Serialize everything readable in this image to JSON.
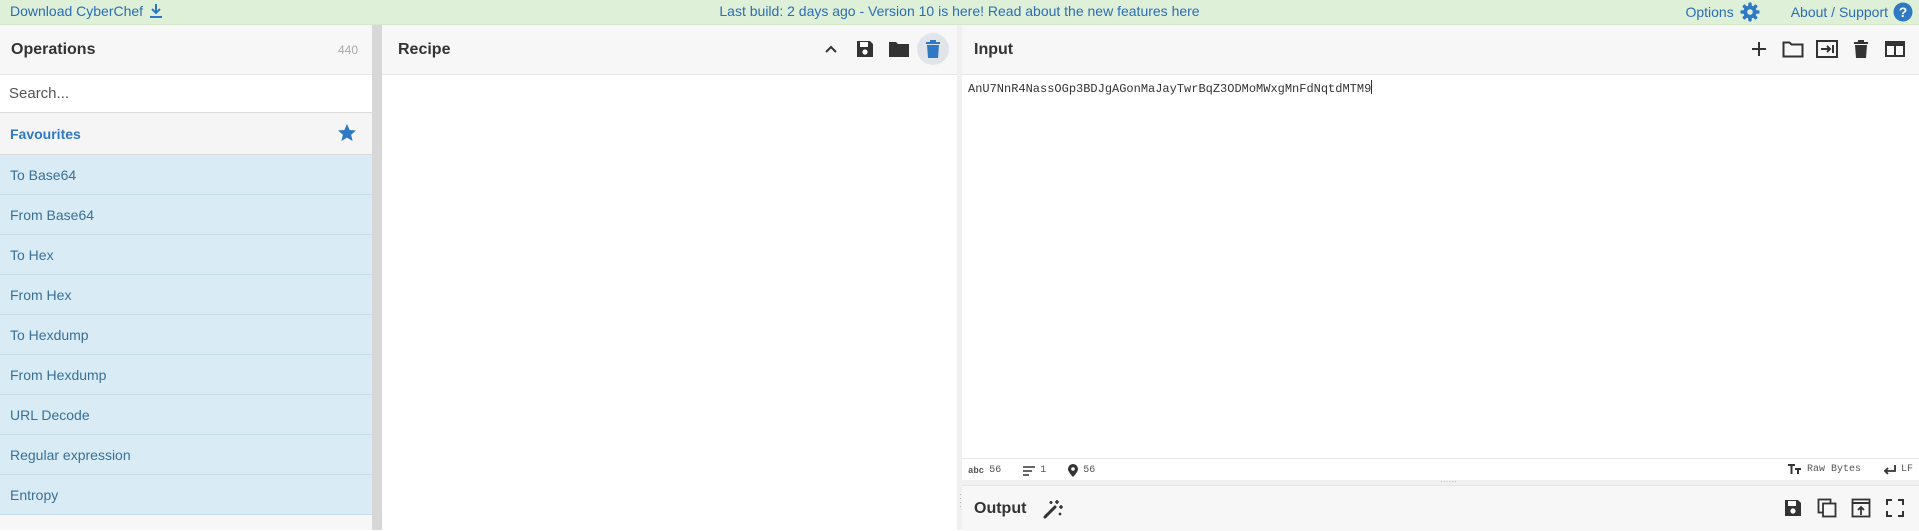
{
  "banner": {
    "download_label": "Download CyberChef",
    "notice": "Last build: 2 days ago - Version 10 is here! Read about the new features here",
    "options_label": "Options",
    "about_label": "About / Support"
  },
  "operations": {
    "title": "Operations",
    "count": "440",
    "search_placeholder": "Search...",
    "favourites_label": "Favourites",
    "items": [
      {
        "label": "To Base64"
      },
      {
        "label": "From Base64"
      },
      {
        "label": "To Hex"
      },
      {
        "label": "From Hex"
      },
      {
        "label": "To Hexdump"
      },
      {
        "label": "From Hexdump"
      },
      {
        "label": "URL Decode"
      },
      {
        "label": "Regular expression"
      },
      {
        "label": "Entropy"
      }
    ]
  },
  "recipe": {
    "title": "Recipe"
  },
  "input": {
    "title": "Input",
    "value": "AnU7NnR4NassOGp3BDJgAGonMaJayTwrBqZ3ODMoMWxgMnFdNqtdMTM9",
    "status": {
      "chars_label": "abc",
      "chars": "56",
      "lines": "1",
      "position": "56",
      "encoding": "Raw Bytes",
      "eol": "LF"
    }
  },
  "output": {
    "title": "Output"
  },
  "colors": {
    "accent": "#2e78c4",
    "banner_bg": "#dff0d8",
    "op_list_bg": "#d9ecf5"
  }
}
